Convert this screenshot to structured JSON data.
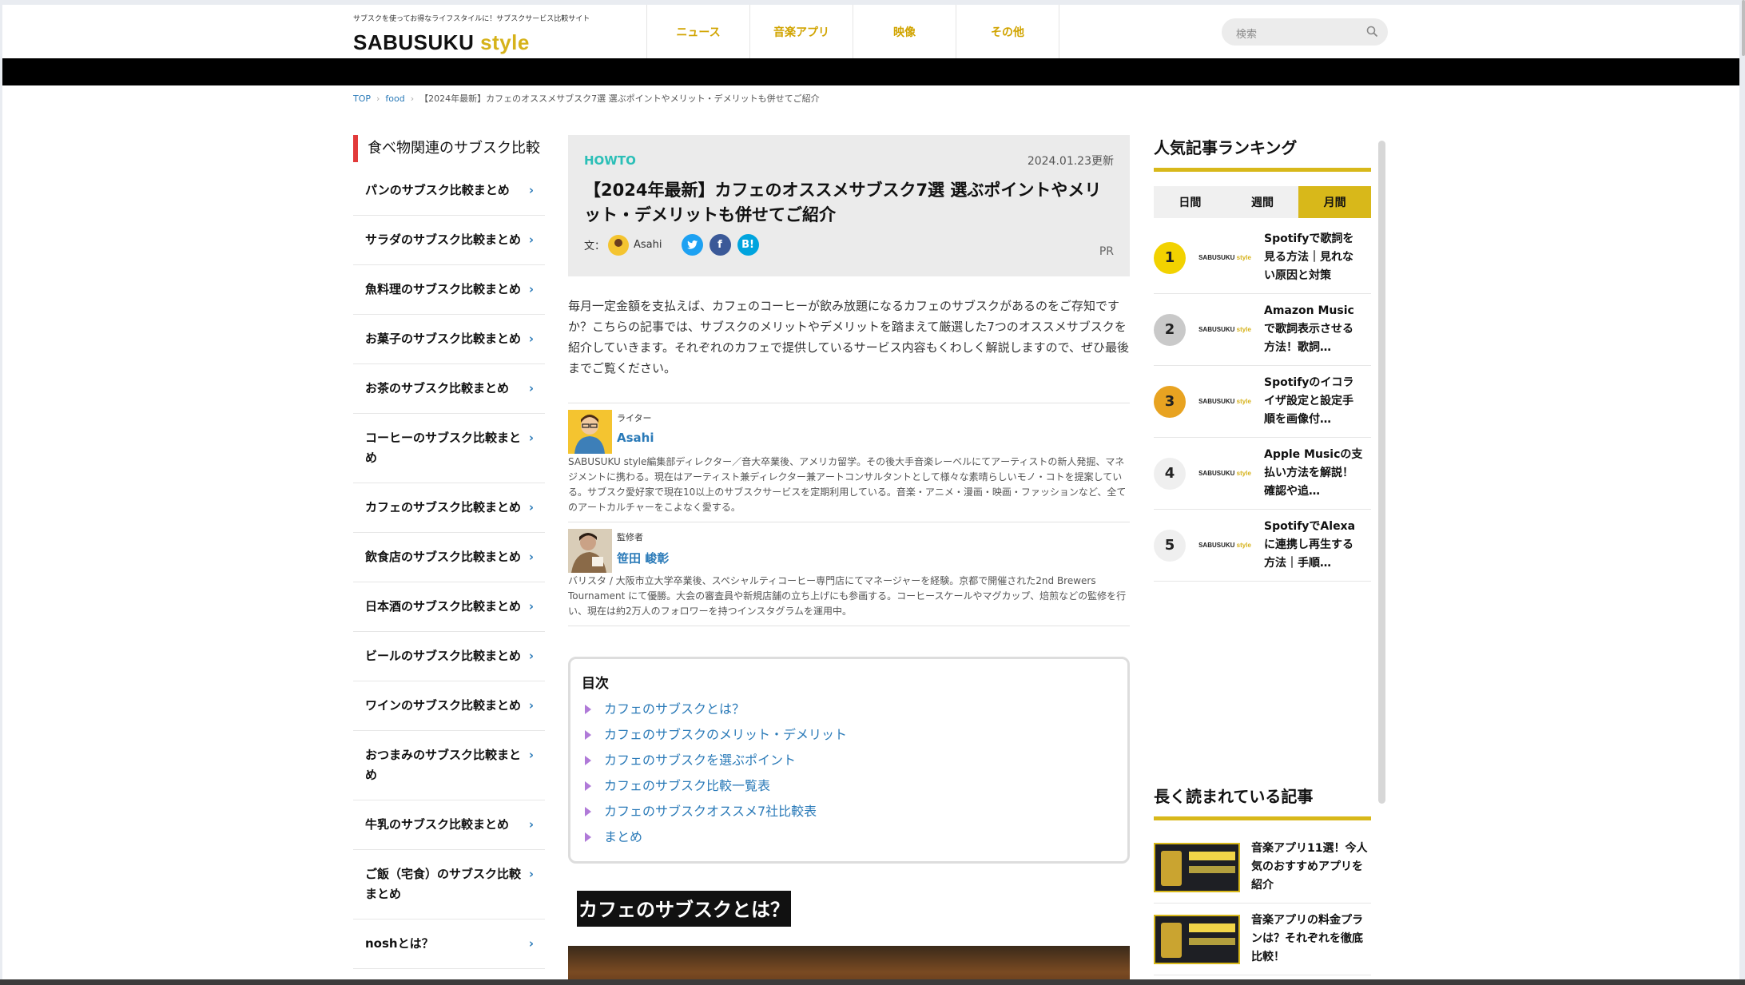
{
  "header": {
    "tagline": "サブスクを使ってお得なライフスタイルに！サブスクサービス比較サイト",
    "logo_main": "SABUSUKU",
    "logo_accent": "style",
    "nav": [
      "ニュース",
      "音楽アプリ",
      "映像",
      "その他"
    ],
    "search_placeholder": "検索"
  },
  "breadcrumb": {
    "top": "TOP",
    "category": "food",
    "current": "【2024年最新】カフェのオススメサブスク7選 選ぶポイントやメリット・デメリットも併せてご紹介"
  },
  "sidebar_left": {
    "heading": "食べ物関連のサブスク比較",
    "items": [
      "パンのサブスク比較まとめ",
      "サラダのサブスク比較まとめ",
      "魚料理のサブスク比較まとめ",
      "お菓子のサブスク比較まとめ",
      "お茶のサブスク比較まとめ",
      "コーヒーのサブスク比較まとめ",
      "カフェのサブスク比較まとめ",
      "飲食店のサブスク比較まとめ",
      "日本酒のサブスク比較まとめ",
      "ビールのサブスク比較まとめ",
      "ワインのサブスク比較まとめ",
      "おつまみのサブスク比較まとめ",
      "牛乳のサブスク比較まとめ",
      "ご飯（宅食）のサブスク比較まとめ",
      "noshとは？"
    ]
  },
  "article": {
    "category": "HOWTO",
    "date": "2024.01.23更新",
    "title": "【2024年最新】カフェのオススメサブスク7選 選ぶポイントやメリット・デメリットも併せてご紹介",
    "byline_label": "文：",
    "author": "Asahi",
    "pr": "PR",
    "intro": "毎月一定金額を支払えば、カフェのコーヒーが飲み放題になるカフェのサブスクがあるのをご存知ですか？こちらの記事では、サブスクのメリットやデメリットを踏まえて厳選した7つのオススメサブスクを紹介していきます。それぞれのカフェで提供しているサービス内容もくわしく解説しますので、ぜひ最後までご覧ください。",
    "writer": {
      "role": "ライター",
      "name": "Asahi",
      "bio": "SABUSUKU style編集部ディレクター／音大卒業後、アメリカ留学。その後大手音楽レーベルにてアーティストの新人発掘、マネジメントに携わる。現在はアーティスト兼ディレクター兼アートコンサルタントとして様々な素晴らしいモノ・コトを提案している。サブスク愛好家で現在10以上のサブスクサービスを定期利用している。音楽・アニメ・漫画・映画・ファッションなど、全てのアートカルチャーをこよなく愛する。"
    },
    "supervisor": {
      "role": "監修者",
      "name": "笹田 峻彰",
      "bio": "バリスタ / 大阪市立大学卒業後、スペシャルティコーヒー専門店にてマネージャーを経験。京都で開催された2nd Brewers Tournament にて優勝。大会の審査員や新規店舗の立ち上げにも参画する。コーヒースケールやマグカップ、焙煎などの監修を行い、現在は約2万人のフォロワーを持つインスタグラムを運用中。"
    },
    "toc": {
      "title": "目次",
      "items": [
        "カフェのサブスクとは？",
        "カフェのサブスクのメリット・デメリット",
        "カフェのサブスクを選ぶポイント",
        "カフェのサブスク比較一覧表",
        "カフェのサブスクオススメ7社比較表",
        "まとめ"
      ]
    },
    "section_heading": "カフェのサブスクとは？"
  },
  "sidebar_right": {
    "ranking_heading": "人気記事ランキング",
    "tabs": [
      "日間",
      "週間",
      "月間"
    ],
    "active_tab": "月間",
    "thumb_logo_main": "SABUSUKU",
    "thumb_logo_accent": "style",
    "ranking": [
      {
        "rank": "1",
        "title": "Spotifyで歌詞を見る方法｜見れない原因と対策",
        "color": "#f2d200"
      },
      {
        "rank": "2",
        "title": "Amazon Musicで歌詞表示させる方法！歌詞…",
        "color": "#c9c9c9"
      },
      {
        "rank": "3",
        "title": "Spotifyのイコライザ設定と設定手順を画像付…",
        "color": "#e8a321"
      },
      {
        "rank": "4",
        "title": "Apple Musicの支払い方法を解説！確認や追…",
        "color": "#efefef"
      },
      {
        "rank": "5",
        "title": "SpotifyでAlexaに連携し再生する方法｜手順…",
        "color": "#efefef"
      }
    ],
    "long_heading": "長く読まれている記事",
    "long_read": [
      {
        "title": "音楽アプリ11選！今人気のおすすめアプリを紹介"
      },
      {
        "title": "音楽アプリの料金プランは？それぞれを徹底比較！"
      }
    ]
  },
  "colors": {
    "accent_yellow": "#d8b81a",
    "link_blue": "#2a7ab8",
    "howto_teal": "#2bbfb7",
    "heading_red": "#e23a3a"
  }
}
